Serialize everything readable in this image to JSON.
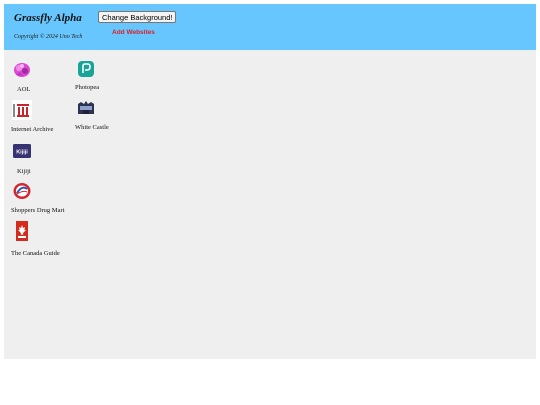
{
  "header": {
    "title": "Grassfly Alpha",
    "copyright": "Copyright © 2024 Uno Tech",
    "change_background_label": "Change Background!",
    "add_websites_label": "Add Websites"
  },
  "colors": {
    "header_bg": "#66c6fd",
    "content_bg": "#efefef",
    "add_websites": "#d8232a"
  },
  "shortcuts": [
    {
      "label": "AOL",
      "icon": "aol-logo-icon"
    },
    {
      "label": "Photopea",
      "icon": "photopea-logo-icon"
    },
    {
      "label": "Internet Archive",
      "icon": "internet-archive-logo-icon"
    },
    {
      "label": "White Castle",
      "icon": "white-castle-logo-icon"
    },
    {
      "label": "Kijiji",
      "icon": "kijiji-logo-icon"
    },
    {
      "label": "Shoppers Drug Mart",
      "icon": "shoppers-drug-mart-logo-icon"
    },
    {
      "label": "The Canada Guide",
      "icon": "canada-flag-icon"
    }
  ],
  "kijiji_logo_text": "Kijiji"
}
